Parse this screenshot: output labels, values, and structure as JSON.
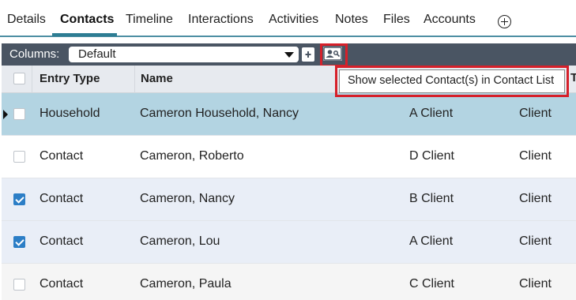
{
  "tabs": [
    {
      "label": "Details"
    },
    {
      "label": "Contacts"
    },
    {
      "label": "Timeline"
    },
    {
      "label": "Interactions"
    },
    {
      "label": "Activities"
    },
    {
      "label": "Notes"
    },
    {
      "label": "Files"
    },
    {
      "label": "Accounts"
    }
  ],
  "active_tab": "Contacts",
  "columns_bar": {
    "label": "Columns:",
    "selected": "Default"
  },
  "table": {
    "headers": [
      "Entry Type",
      "Name"
    ],
    "rows": [
      {
        "type": "Household",
        "name": "Cameron Household, Nancy",
        "class": "A Client",
        "status": "Client",
        "checked": false,
        "current": true
      },
      {
        "type": "Contact",
        "name": "Cameron, Roberto",
        "class": "D Client",
        "status": "Client",
        "checked": false,
        "current": false
      },
      {
        "type": "Contact",
        "name": "Cameron, Nancy",
        "class": "B Client",
        "status": "Client",
        "checked": true,
        "current": false
      },
      {
        "type": "Contact",
        "name": "Cameron, Lou",
        "class": "A Client",
        "status": "Client",
        "checked": true,
        "current": false
      },
      {
        "type": "Contact",
        "name": "Cameron, Paula",
        "class": "C Client",
        "status": "Client",
        "checked": false,
        "current": false
      }
    ]
  },
  "tooltip": {
    "text": "Show selected Contact(s) in Contact List",
    "trailing": "T"
  },
  "colors": {
    "accent": "#2d7d93",
    "toolbar": "#4a5563",
    "highlight_row": "#b3d4e2",
    "selected_row": "#e9eef7",
    "callout": "#d6202a",
    "checkbox": "#2c7ec6"
  },
  "icons": [
    "add-tab-icon",
    "dropdown-arrow-icon",
    "export-icon",
    "contact-card-icon",
    "row-pointer-icon",
    "checkbox-icon"
  ]
}
